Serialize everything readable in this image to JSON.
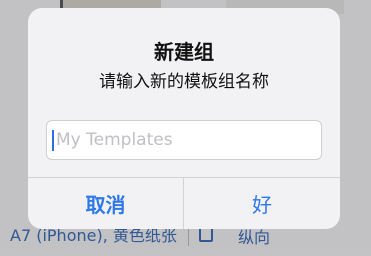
{
  "background": {
    "paper_caption": "A7 (iPhone), 黄色纸张",
    "orientation_label": "纵向"
  },
  "alert": {
    "title": "新建组",
    "message": "请输入新的模板组名称",
    "input": {
      "value": "",
      "placeholder": "My Templates"
    },
    "buttons": {
      "cancel": "取消",
      "ok": "好"
    }
  },
  "colors": {
    "accent": "#2f78e8",
    "caret": "#2d6fe0",
    "background_link": "#3c69b0"
  }
}
